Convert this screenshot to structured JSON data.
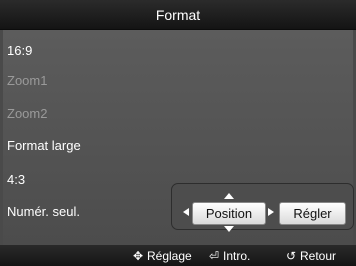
{
  "title": "Format",
  "menu": {
    "items": [
      {
        "label": "16:9",
        "enabled": true
      },
      {
        "label": "Zoom1",
        "enabled": false
      },
      {
        "label": "Zoom2",
        "enabled": false
      },
      {
        "label": "Format large",
        "enabled": true
      },
      {
        "label": "4:3",
        "enabled": true
      },
      {
        "label": "Numér. seul.",
        "enabled": true
      }
    ]
  },
  "controls": {
    "position_label": "Position",
    "regler_label": "Régler"
  },
  "footer": {
    "reglage": {
      "icon": "move-arrows-icon",
      "glyph": "✥",
      "label": "Réglage"
    },
    "intro": {
      "icon": "enter-icon",
      "glyph": "⏎",
      "label": "Intro."
    },
    "retour": {
      "icon": "return-icon",
      "glyph": "↺",
      "label": "Retour"
    }
  },
  "colors": {
    "enabled_text": "#ffffff",
    "disabled_text": "#9a9a9a",
    "bar": "#1e1e1e",
    "body": "#555555"
  }
}
